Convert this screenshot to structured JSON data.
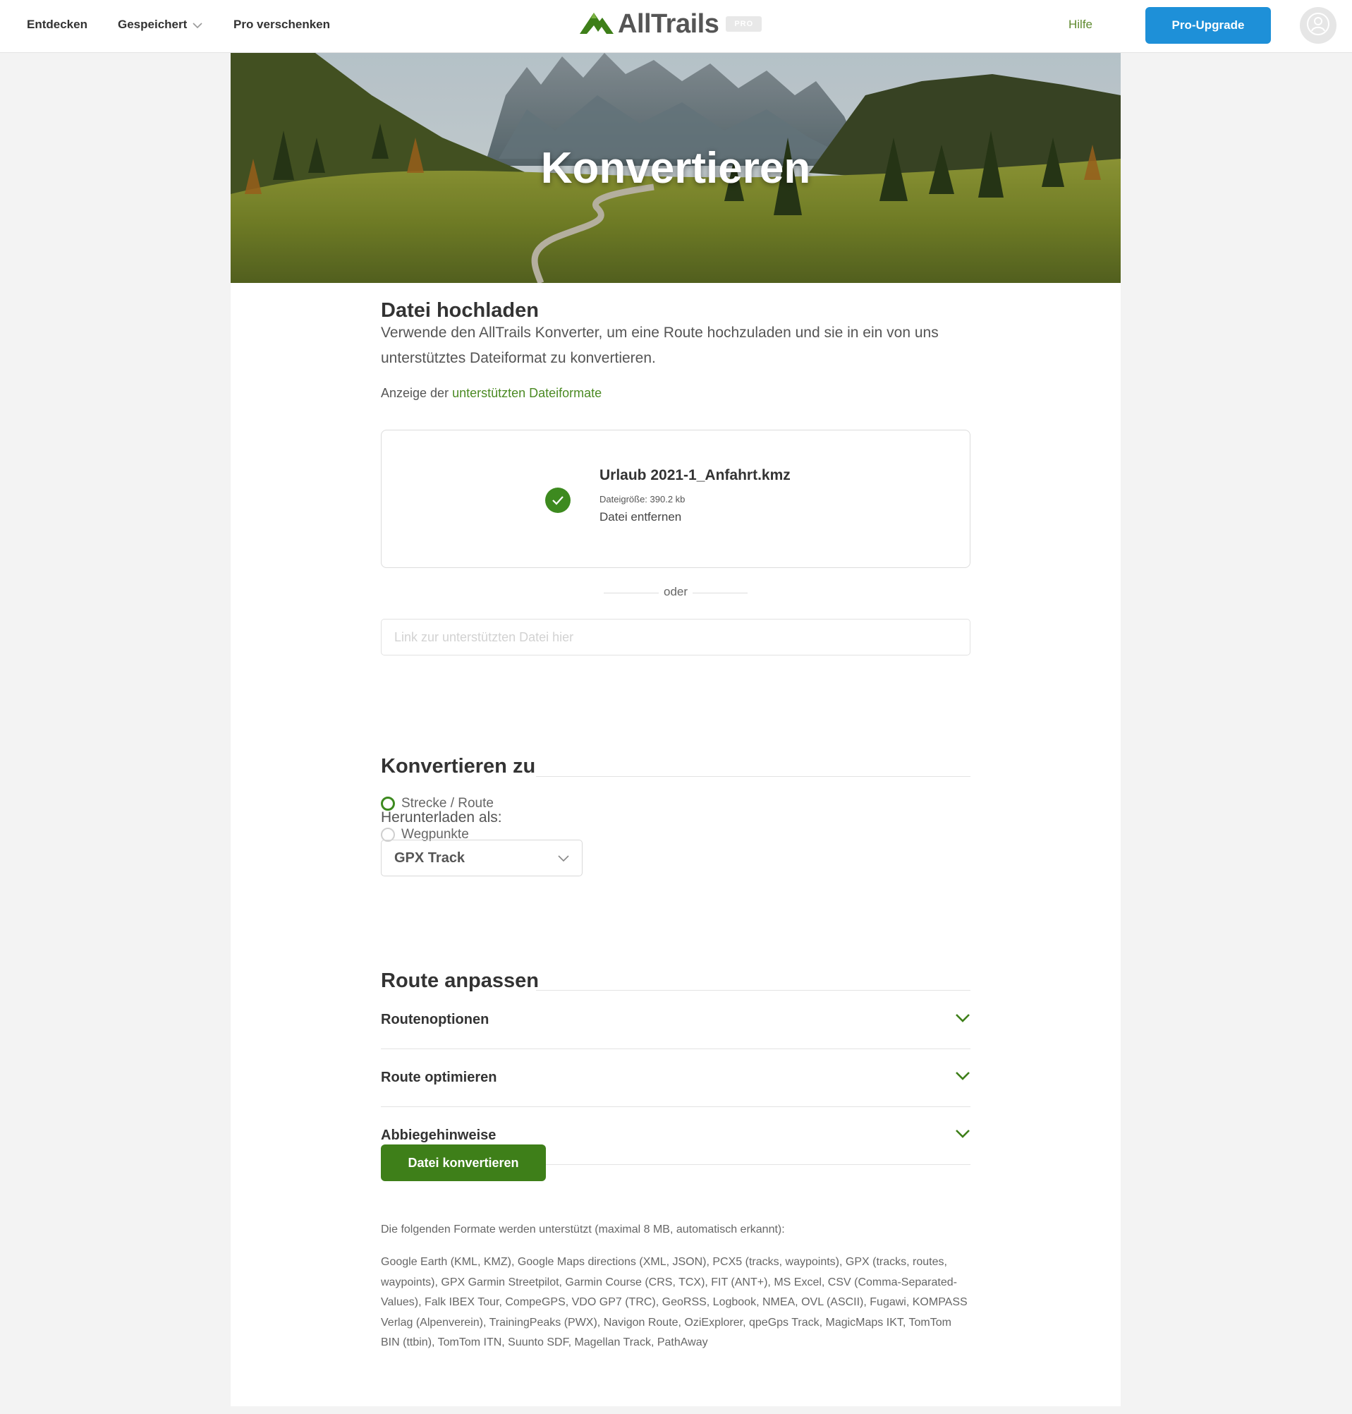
{
  "nav": {
    "discover": "Entdecken",
    "saved": "Gespeichert",
    "gift_pro": "Pro verschenken",
    "help": "Hilfe",
    "upgrade": "Pro-Upgrade"
  },
  "logo": {
    "text": "AllTrails",
    "badge": "PRO"
  },
  "hero": {
    "title": "Konvertieren"
  },
  "upload": {
    "heading": "Datei hochladen",
    "intro": "Verwende den AllTrails Konverter, um eine Route hochzuladen und sie in ein von uns unterstütztes Dateiformat zu konvertieren.",
    "formats_prefix": "Anzeige der ",
    "formats_link": "unterstützten Dateiformate",
    "file_name": "Urlaub 2021-1_Anfahrt.kmz",
    "file_size": "Dateigröße: 390.2 kb",
    "remove": "Datei entfernen",
    "or": "oder",
    "link_placeholder": "Link zur unterstützten Datei hier"
  },
  "convert": {
    "heading": "Konvertieren zu",
    "option_track": "Strecke / Route",
    "option_waypoints": "Wegpunkte",
    "selected_option": "Strecke / Route",
    "download_label": "Herunterladen als:",
    "download_value": "GPX Track"
  },
  "customize": {
    "heading": "Route anpassen",
    "items": [
      {
        "label": "Routenoptionen"
      },
      {
        "label": "Route optimieren"
      },
      {
        "label": "Abbiegehinweise"
      }
    ]
  },
  "convert_button": "Datei konvertieren",
  "supported": {
    "heading": "Die folgenden Formate werden unterstützt (maximal 8 MB, automatisch erkannt):",
    "list": "Google Earth (KML, KMZ), Google Maps directions (XML, JSON), PCX5 (tracks, waypoints), GPX (tracks, routes, waypoints), GPX Garmin Streetpilot, Garmin Course (CRS, TCX), FIT (ANT+), MS Excel, CSV (Comma-Separated-Values), Falk IBEX Tour, CompeGPS, VDO GP7 (TRC), GeoRSS, Logbook, NMEA, OVL (ASCII), Fugawi, KOMPASS Verlag (Alpenverein), TrainingPeaks (PWX), Navigon Route, OziExplorer, qpeGps Track, MagicMaps IKT, TomTom BIN (ttbin), TomTom ITN, Suunto SDF, Magellan Track, PathAway"
  },
  "colors": {
    "brand_green": "#3e7f19",
    "link_green": "#4b8a23",
    "upgrade_blue": "#1e90d8"
  }
}
